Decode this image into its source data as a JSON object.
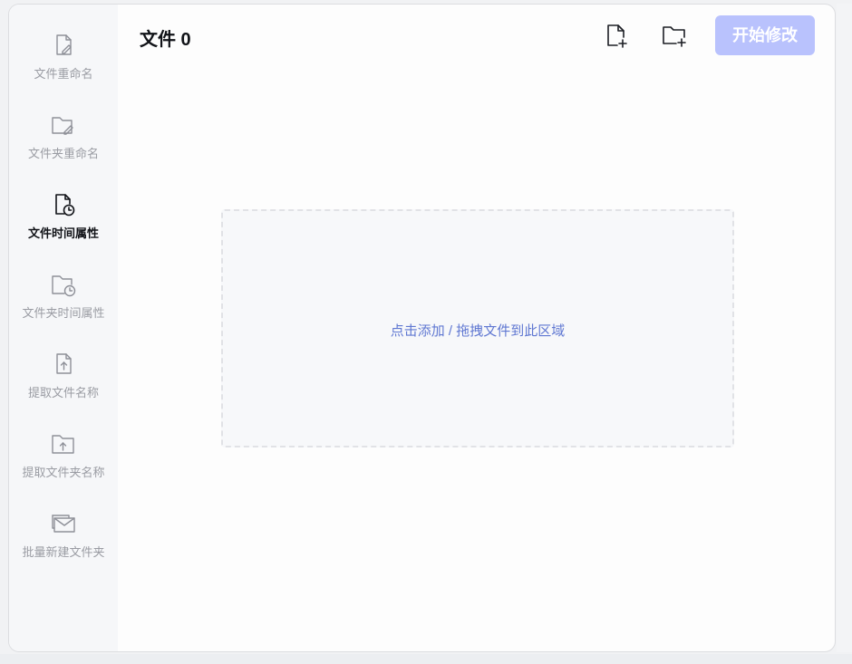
{
  "sidebar": {
    "items": [
      {
        "label": "文件重命名",
        "icon": "file-edit-icon",
        "active": false
      },
      {
        "label": "文件夹重命名",
        "icon": "folder-edit-icon",
        "active": false
      },
      {
        "label": "文件时间属性",
        "icon": "file-clock-icon",
        "active": true
      },
      {
        "label": "文件夹时间属性",
        "icon": "folder-clock-icon",
        "active": false
      },
      {
        "label": "提取文件名称",
        "icon": "file-upload-icon",
        "active": false
      },
      {
        "label": "提取文件夹名称",
        "icon": "folder-upload-icon",
        "active": false
      },
      {
        "label": "批量新建文件夹",
        "icon": "batch-folder-icon",
        "active": false
      }
    ]
  },
  "header": {
    "file_count_label": "文件 0",
    "add_file_icon": "add-file-icon",
    "add_folder_icon": "add-folder-icon",
    "start_button_label": "开始修改"
  },
  "dropzone": {
    "hint": "点击添加 / 拖拽文件到此区域"
  },
  "colors": {
    "accent_disabled": "#b9c2fd",
    "hint_text": "#6078d2",
    "sidebar_bg": "#f6f7f9",
    "active_text": "#111318",
    "inactive_text": "#9a9ca3"
  }
}
